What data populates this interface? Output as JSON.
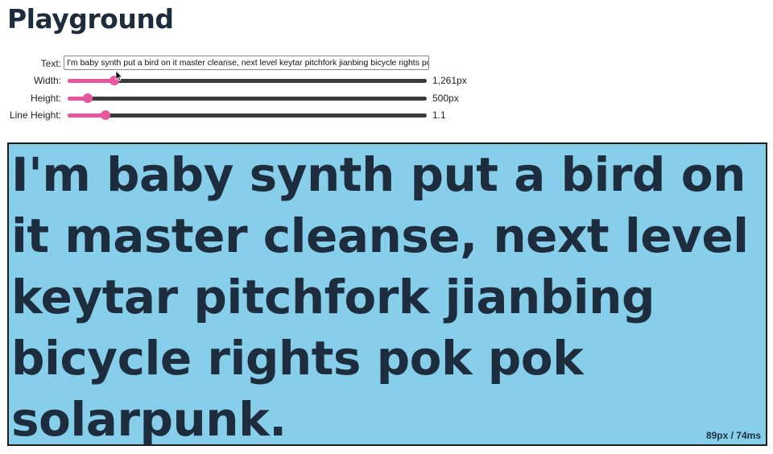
{
  "page": {
    "title": "Playground"
  },
  "controls": {
    "text": {
      "label": "Text:",
      "value": "I'm baby synth put a bird on it master cleanse, next level keytar pitchfork jianbing bicycle rights pok pok solarpunk."
    },
    "width": {
      "label": "Width:",
      "value_text": "1,261px",
      "fraction": 0.13
    },
    "height": {
      "label": "Height:",
      "value_text": "500px",
      "fraction": 0.055
    },
    "line_height": {
      "label": "Line Height:",
      "value_text": "1.1",
      "fraction": 0.106
    }
  },
  "preview": {
    "text": "I'm baby synth put a bird on it master cleanse, next level keytar pitchfork jianbing bicycle rights pok pok solarpunk.",
    "metrics": "89px / 74ms"
  },
  "colors": {
    "accent": "#e8569e",
    "track": "#3b3b3b",
    "preview_bg": "#87ceeb",
    "text": "#1e2d3d"
  }
}
